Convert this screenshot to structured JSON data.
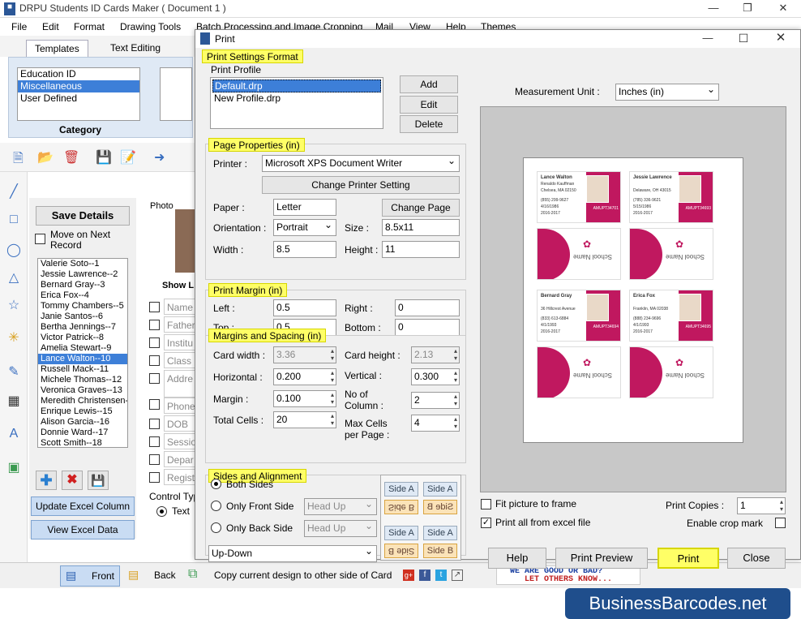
{
  "app": {
    "title": "DRPU Students ID Cards Maker ( Document 1 )",
    "menu": [
      "File",
      "Edit",
      "Format",
      "Drawing Tools",
      "Batch Processing and Image Cropping",
      "Mail",
      "View",
      "Help",
      "Themes"
    ],
    "ribbon_tabs": [
      "Templates",
      "Text Editing"
    ],
    "category_label": "Category",
    "categories": [
      "Education ID",
      "Miscellaneous",
      "User Defined"
    ],
    "selected_category": "Miscellaneous"
  },
  "panel": {
    "save_details": "Save Details",
    "move_next": "Move on Next Record",
    "records": [
      "Valerie Soto--1",
      "Jessie Lawrence--2",
      "Bernard Gray--3",
      "Erica Fox--4",
      "Tommy Chambers--5",
      "Janie Santos--6",
      "Bertha Jennings--7",
      "Victor Patrick--8",
      "Amelia Stewart--9",
      "Lance Walton--10",
      "Russell Mack--11",
      "Michele Thomas--12",
      "Veronica Graves--13",
      "Meredith Christensen--14",
      "Enrique Lewis--15",
      "Alison Garcia--16",
      "Donnie Ward--17",
      "Scott Smith--18"
    ],
    "selected_record": "Lance Walton--10",
    "update_excel": "Update Excel Column",
    "view_excel": "View Excel Data",
    "photo_label": "Photo",
    "show_label": "Show L",
    "fields": [
      "Name",
      "Father",
      "Institu",
      "Class",
      "Addre",
      "Phone",
      "DOB",
      "Sessio",
      "Depar",
      "Regist"
    ],
    "control_type": "Control Typ",
    "text_option": "Text"
  },
  "bottom": {
    "front": "Front",
    "back": "Back",
    "copy_design": "Copy current design to other side of Card",
    "feedback_line1": "WE ARE GOOD OR BAD?",
    "feedback_line2": "LET OTHERS KNOW...",
    "brand": "BusinessBarcodes.net"
  },
  "dialog": {
    "title": "Print",
    "print_settings_format": "Print Settings Format",
    "print_profile_label": "Print Profile",
    "profiles": [
      "Default.drp",
      "New Profile.drp"
    ],
    "selected_profile": "Default.drp",
    "add": "Add",
    "edit": "Edit",
    "delete": "Delete",
    "page_properties": "Page Properties  (in)",
    "printer_label": "Printer :",
    "printer_value": "Microsoft XPS Document Writer",
    "change_printer": "Change Printer Setting",
    "paper_label": "Paper :",
    "paper_value": "Letter",
    "change_page": "Change Page",
    "orientation_label": "Orientation :",
    "orientation_value": "Portrait",
    "size_label": "Size :",
    "size_value": "8.5x11",
    "width_label": "Width :",
    "width_value": "8.5",
    "height_label": "Height :",
    "height_value": "11",
    "print_margin": "Print Margin (in)",
    "left_label": "Left :",
    "left_value": "0.5",
    "right_label": "Right :",
    "right_value": "0",
    "top_label": "Top :",
    "top_value": "0.5",
    "bottom_label": "Bottom :",
    "bottom_value": "0",
    "margins_spacing": "Margins and Spacing  (in)",
    "card_width_label": "Card width :",
    "card_width_value": "3.36",
    "card_height_label": "Card height :",
    "card_height_value": "2.13",
    "horizontal_label": "Horizontal :",
    "horizontal_value": "0.200",
    "vertical_label": "Vertical :",
    "vertical_value": "0.300",
    "margin_label": "Margin :",
    "margin_value": "0.100",
    "no_column_label": "No of Column :",
    "no_column_value": "2",
    "total_cells_label": "Total Cells :",
    "total_cells_value": "20",
    "max_cells_label": "Max Cells per Page :",
    "max_cells_value": "4",
    "sides_alignment": "Sides and Alignment",
    "both_sides": "Both Sides",
    "only_front": "Only Front Side",
    "only_back": "Only Back Side",
    "head_up": "Head Up",
    "up_down": "Up-Down",
    "side_a": "Side A",
    "side_b": "Side B",
    "measurement_unit_label": "Measurement Unit :",
    "measurement_unit_value": "Inches (in)",
    "fit_picture": "Fit picture to frame",
    "print_all_excel": "Print all from excel file",
    "print_copies_label": "Print Copies :",
    "print_copies_value": "1",
    "enable_crop": "Enable crop mark",
    "help": "Help",
    "print_preview": "Print Preview",
    "print": "Print",
    "close": "Close"
  },
  "preview_cards": [
    {
      "name": "Lance Walton",
      "sub": "Renaldo Kauffman",
      "addr": "Chelsea, MA 02150",
      "phone": "(855) 299-9627",
      "d1": "4/16/1986",
      "d2": "2016-2017",
      "id": "AMUPT34701"
    },
    {
      "name": "Jessie Lawrence",
      "sub": "",
      "addr": "Delaware, OH 43015",
      "phone": "(785) 336-9621",
      "d1": "5/15/1986",
      "d2": "2016-2017",
      "id": "AMUPT34693"
    },
    {
      "name": "Bernard Gray",
      "sub": "",
      "addr": "36 Hillcrest Avenue",
      "phone": "(833) 613-6884",
      "d1": "4/1/1993",
      "d2": "2016-2017",
      "id": "AMUPT34694"
    },
    {
      "name": "Erica Fox",
      "sub": "",
      "addr": "Franklin, MA 02038",
      "phone": "(888) 234-9696",
      "d1": "4/1/1993",
      "d2": "2016-2017",
      "id": "AMUPT34695"
    }
  ],
  "back_label": "School Name"
}
